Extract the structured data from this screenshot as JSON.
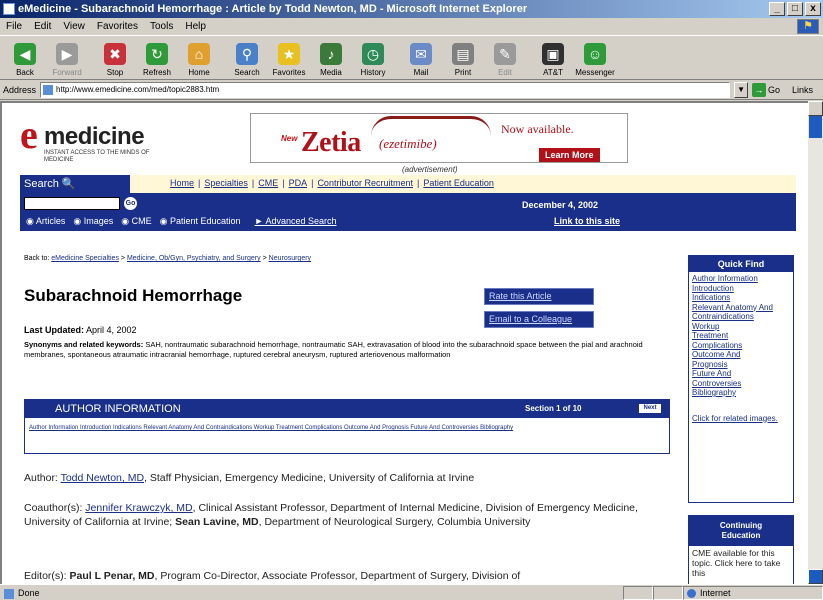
{
  "window": {
    "title": "eMedicine - Subarachnoid Hemorrhage : Article by Todd Newton, MD - Microsoft Internet Explorer",
    "min": "_",
    "max": "□",
    "close": "x"
  },
  "menu": [
    "File",
    "Edit",
    "View",
    "Favorites",
    "Tools",
    "Help"
  ],
  "toolbar": [
    {
      "label": "Back",
      "icon": "back-arrow-icon",
      "color": "#2f9a3a"
    },
    {
      "label": "Forward",
      "icon": "forward-arrow-icon",
      "color": "#9a9a9a",
      "disabled": true
    },
    {
      "label": "Stop",
      "icon": "stop-icon",
      "color": "#c8303a"
    },
    {
      "label": "Refresh",
      "icon": "refresh-icon",
      "color": "#2f9a3a"
    },
    {
      "label": "Home",
      "icon": "home-icon",
      "color": "#e0a030"
    },
    {
      "label": "Search",
      "icon": "search-icon",
      "color": "#4a80c8"
    },
    {
      "label": "Favorites",
      "icon": "star-icon",
      "color": "#e8c020"
    },
    {
      "label": "Media",
      "icon": "media-icon",
      "color": "#3a7a3a"
    },
    {
      "label": "History",
      "icon": "history-icon",
      "color": "#2f8a5a"
    },
    {
      "label": "Mail",
      "icon": "mail-icon",
      "color": "#6a8ac8"
    },
    {
      "label": "Print",
      "icon": "print-icon",
      "color": "#808080"
    },
    {
      "label": "Edit",
      "icon": "edit-icon",
      "color": "#9a9a9a",
      "disabled": true
    },
    {
      "label": "AT&T",
      "icon": "att-icon",
      "color": "#303030"
    },
    {
      "label": "Messenger",
      "icon": "messenger-icon",
      "color": "#2f9a3a"
    }
  ],
  "address": {
    "label": "Address",
    "url": "http://www.emedicine.com/med/topic2883.htm",
    "go": "Go",
    "links": "Links"
  },
  "site": {
    "logo_word": "medicine",
    "logo_tagline": "INSTANT ACCESS TO THE MINDS OF MEDICINE",
    "ad": {
      "new": "New",
      "brand": "Zetia",
      "generic": "(ezetimibe)",
      "available": "Now available.",
      "cta": "Learn More",
      "label": "(advertisement)"
    },
    "search_label": "Search",
    "nav": [
      "Home",
      "Specialties",
      "CME",
      "PDA",
      "Contributor Recruitment",
      "Patient Education"
    ],
    "search_options": [
      "Articles",
      "Images",
      "CME",
      "Patient Education"
    ],
    "advanced_search": "Advanced Search",
    "date": "December 4, 2002",
    "link_to_site": "Link to this site"
  },
  "article": {
    "breadcrumb_prefix": "Back to:",
    "breadcrumb": [
      "eMedicine Specialties",
      "Medicine, Ob/Gyn, Psychiatry, and Surgery",
      "Neurosurgery"
    ],
    "title": "Subarachnoid Hemorrhage",
    "rate": "Rate this Article",
    "email": "Email to a Colleague",
    "updated_label": "Last Updated:",
    "updated_value": "April 4, 2002",
    "synonyms_label": "Synonyms and related keywords:",
    "synonyms_text": "SAH, nontraumatic subarachnoid hemorrhage, nontraumatic SAH, extravasation of blood into the subarachnoid space between the pial and arachnoid membranes, spontaneous atraumatic intracranial hemorrhage, ruptured cerebral aneurysm, ruptured arteriovenous malformation",
    "author_box": {
      "heading": "AUTHOR INFORMATION",
      "section": "Section 1 of 10",
      "next": "Next",
      "toc": "Author Information Introduction Indications Relevant Anatomy And Contraindications Workup Treatment Complications Outcome And Prognosis Future And Controversies Bibliography"
    },
    "author_prefix": "Author:",
    "author_name": "Todd Newton, MD",
    "author_desc": ", Staff Physician, Emergency Medicine, University of California at Irvine",
    "coauthor_prefix": "Coauthor(s):",
    "coauthor1_name": "Jennifer Krawczyk, MD",
    "coauthor1_desc": ", Clinical Assistant Professor, Department of Internal Medicine, Division of Emergency Medicine, University of California at Irvine;",
    "coauthor2_name": "Sean Lavine, MD",
    "coauthor2_desc": ", Department of Neurological Surgery, Columbia University",
    "editor_prefix": "Editor(s):",
    "editor_name": "Paul L Penar, MD",
    "editor_desc": ", Program Co-Director, Associate Professor, Department of Surgery, Division of"
  },
  "quickfind": {
    "heading": "Quick Find",
    "items": [
      "Author Information",
      "Introduction",
      "Indications",
      "Relevant Anatomy And",
      "Contraindications",
      "Workup",
      "Treatment",
      "Complications",
      "Outcome And",
      "Prognosis",
      "Future And",
      "Controversies",
      "Bibliography"
    ],
    "related": "Click for related images."
  },
  "cme": {
    "heading_1": "Continuing",
    "heading_2": "Education",
    "body": "CME available for this topic. Click here to take this"
  },
  "status": {
    "text": "Done",
    "zone": "Internet"
  }
}
